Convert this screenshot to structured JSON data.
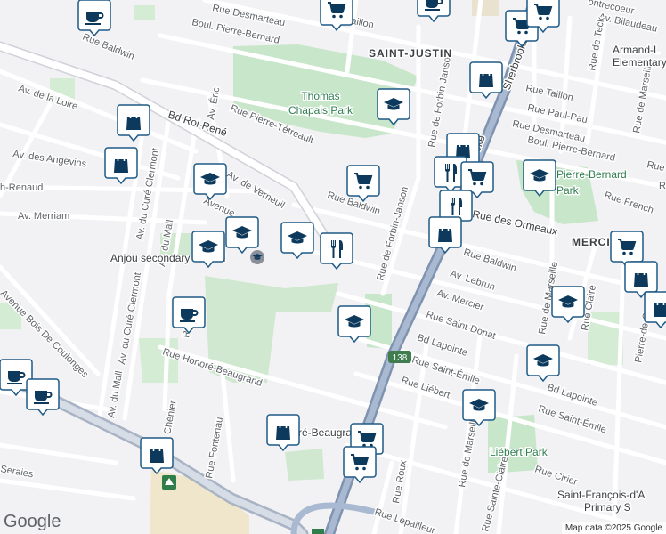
{
  "footer": {
    "logo": "Google",
    "copyright": "Map data ©2025 Google"
  },
  "areas": {
    "saint_justin": "SAINT-JUSTIN",
    "mercier": "MERCIER"
  },
  "parks": {
    "thomas_l1": "Thomas",
    "thomas_l2": "Chapais Park",
    "pierre_l1": "Pierre-Bernard",
    "pierre_l2": "Park",
    "liebert": "Liébert Park"
  },
  "places": {
    "anjou": "Anjou secondary School",
    "armand_l1": "Armand-L",
    "armand_l2": "Elementary",
    "stfrancois_l1": "Saint-François-d'A",
    "stfrancois_l2": "Primary S"
  },
  "streets": {
    "desmarteau_n": "Rue Desmarteau",
    "baillon": "Rue Baillon",
    "contrecoeur": "ontrecoeur",
    "bilaudeau": "Av. Bilaudeau",
    "baldwin_w": "Rue Baldwin",
    "pierre_bernard_n": "Boul. Pierre-Bernard",
    "sherbrooke": "Sherbrooke",
    "taillon": "Rue Taillon",
    "paulpau": "Rue Paul-Pau",
    "desmarteau_e": "Rue Desmarteau",
    "pierre_bernard_e": "Boul. Pierre-Bernard",
    "teck": "Rue de Teck",
    "marseille_ne": "Rue de Marseille",
    "loire": "Av. de la Loire",
    "roirene": "Bd Roi-René",
    "eric": "Av. Éric",
    "pierre_tetreault": "Rue Pierre-Tétreault",
    "angevins": "Av. des Angevins",
    "renaud": "h-Renaud",
    "verneuil": "Av. de Verneuil",
    "avenue_at": "Avenue",
    "merriam": "Av. Merriam",
    "baldwin_c": "Rue Baldwin",
    "forbin_n": "Rue de Forbin-Janson",
    "forbin_c": "Rue de Forbin-Janson",
    "ormeaux": "Rue des Ormeaux",
    "brooke": "ooke",
    "french": "Rue French",
    "baldwin_e": "Rue Baldwin",
    "lebrun": "Av. Lebrun",
    "mercier_av": "Av. Mercier",
    "saint_donat": "Rue Saint-Donat",
    "lapointe_c": "Bd Lapointe",
    "saint_emile_c": "Rue Saint-Émile",
    "liebert_rue": "Rue Liébert",
    "lapointe_e": "Bd Lapointe",
    "saint_emile_e": "Rue Saint-Émile",
    "honore": "Rue Honoré-Beaugrand",
    "honore_b": "ré-Beaugrand",
    "fontenau": "Rue Fontenau",
    "chenier": "Av. Chénier",
    "mall_1": "Av. du Mall",
    "mall_2": "Av. du Mall",
    "cure_1": "Av. du Curé Clermont",
    "cure_2": "Av. du Curé Clermont",
    "bois": "Avenue Bois De Coulonges",
    "seraies": "Seraies",
    "roux": "Rue Roux",
    "lepailleur": "Rue Lepailleur",
    "marseille_s": "Rue de Marseille",
    "sainte_claire": "Rue Sainte-Claire",
    "cirier": "Rue Cirier",
    "coubertin": "Pierre-de-Coubertin",
    "claire_e": "Rue Claire",
    "marseille_e": "Rue de Marseille",
    "ru": "Ru",
    "route138": "138",
    "rue_d": "Rue D",
    "rue_w": "Rue"
  },
  "pins": [
    {
      "id": "cafe-nw",
      "type": "cafe",
      "icon": "coffee-cup-icon"
    },
    {
      "id": "shop-n",
      "type": "shopping",
      "icon": "cart-icon"
    },
    {
      "id": "cafe-n",
      "type": "cafe",
      "icon": "coffee-cup-icon"
    },
    {
      "id": "shop-ne1",
      "type": "shopping",
      "icon": "cart-icon"
    },
    {
      "id": "shop-ne2",
      "type": "shopping",
      "icon": "cart-icon"
    },
    {
      "id": "store-ne",
      "type": "store",
      "icon": "shopping-bag-icon"
    },
    {
      "id": "school-thomas",
      "type": "school",
      "icon": "graduation-cap-icon"
    },
    {
      "id": "store-w1",
      "type": "store",
      "icon": "shopping-bag-icon"
    },
    {
      "id": "store-w2",
      "type": "store",
      "icon": "shopping-bag-icon"
    },
    {
      "id": "school-verneuil",
      "type": "school",
      "icon": "graduation-cap-icon"
    },
    {
      "id": "shop-baldwin",
      "type": "shopping",
      "icon": "cart-icon"
    },
    {
      "id": "school-anjou1",
      "type": "school",
      "icon": "graduation-cap-icon"
    },
    {
      "id": "school-anjou2",
      "type": "school",
      "icon": "graduation-cap-icon"
    },
    {
      "id": "school-anjou3",
      "type": "school",
      "icon": "graduation-cap-icon"
    },
    {
      "id": "food-c",
      "type": "restaurant",
      "icon": "fork-knife-icon"
    },
    {
      "id": "store-forbin",
      "type": "store",
      "icon": "shopping-bag-icon"
    },
    {
      "id": "food-forbin",
      "type": "restaurant",
      "icon": "fork-knife-icon"
    },
    {
      "id": "shop-forbin",
      "type": "shopping",
      "icon": "cart-icon"
    },
    {
      "id": "food-forbin2",
      "type": "restaurant",
      "icon": "fork-knife-icon"
    },
    {
      "id": "store-ormeaux",
      "type": "store",
      "icon": "shopping-bag-icon"
    },
    {
      "id": "school-pierre",
      "type": "school",
      "icon": "graduation-cap-icon"
    },
    {
      "id": "shop-mercier",
      "type": "shopping",
      "icon": "cart-icon"
    },
    {
      "id": "store-e1",
      "type": "store",
      "icon": "shopping-bag-icon"
    },
    {
      "id": "store-e2",
      "type": "store",
      "icon": "shopping-bag-icon"
    },
    {
      "id": "school-e1",
      "type": "school",
      "icon": "graduation-cap-icon"
    },
    {
      "id": "school-e2",
      "type": "school",
      "icon": "graduation-cap-icon"
    },
    {
      "id": "cafe-c",
      "type": "cafe",
      "icon": "coffee-cup-icon"
    },
    {
      "id": "school-c",
      "type": "school",
      "icon": "graduation-cap-icon"
    },
    {
      "id": "cafe-sw1",
      "type": "cafe",
      "icon": "coffee-cup-icon"
    },
    {
      "id": "cafe-sw2",
      "type": "cafe",
      "icon": "coffee-cup-icon"
    },
    {
      "id": "school-liebert",
      "type": "school",
      "icon": "graduation-cap-icon"
    },
    {
      "id": "store-beaugrand",
      "type": "store",
      "icon": "shopping-bag-icon"
    },
    {
      "id": "shop-s1",
      "type": "shopping",
      "icon": "cart-icon"
    },
    {
      "id": "shop-s2",
      "type": "shopping",
      "icon": "cart-icon"
    },
    {
      "id": "store-sw",
      "type": "store",
      "icon": "shopping-bag-icon"
    }
  ]
}
